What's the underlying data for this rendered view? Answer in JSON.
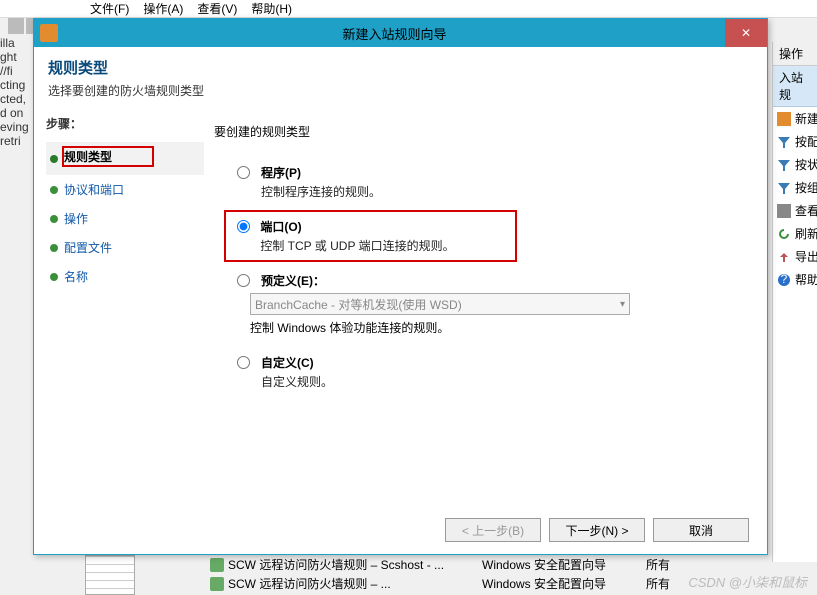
{
  "menubar": {
    "file": "文件(F)",
    "action": "操作(A)",
    "view": "查看(V)",
    "help": "帮助(H)"
  },
  "bg_text_lines": [
    "illa",
    "ght",
    "//fi",
    "cting",
    "cted,",
    "d on",
    "eving",
    "retri"
  ],
  "side": {
    "header": "操作",
    "group": "入站规",
    "items": [
      {
        "icon": "firewall-icon",
        "label": "新建"
      },
      {
        "icon": "filter-icon",
        "label": "按配"
      },
      {
        "icon": "filter-icon",
        "label": "按状"
      },
      {
        "icon": "filter-icon",
        "label": "按组"
      },
      {
        "icon": "view-icon",
        "label": "查看"
      },
      {
        "icon": "refresh-icon",
        "label": "刷新"
      },
      {
        "icon": "export-icon",
        "label": "导出"
      },
      {
        "icon": "help-icon",
        "label": "帮助"
      }
    ]
  },
  "status": {
    "row1": {
      "name": "SCW 远程访问防火墙规则 – Scshost - ...",
      "group": "Windows 安全配置向导",
      "extra": "所有"
    },
    "row2": {
      "name": "SCW 远程访问防火墙规则 – ...",
      "group": "Windows 安全配置向导",
      "extra": "所有"
    }
  },
  "watermark": "CSDN @小柒和鼠标",
  "wizard": {
    "title": "新建入站规则向导",
    "header": {
      "title": "规则类型",
      "subtitle": "选择要创建的防火墙规则类型"
    },
    "steps_label": "步骤：",
    "steps": [
      {
        "label": "规则类型",
        "current": true
      },
      {
        "label": "协议和端口"
      },
      {
        "label": "操作"
      },
      {
        "label": "配置文件"
      },
      {
        "label": "名称"
      }
    ],
    "prompt": "要创建的规则类型",
    "options": {
      "program": {
        "label": "程序(P)",
        "desc": "控制程序连接的规则。"
      },
      "port": {
        "label": "端口(O)",
        "desc": "控制 TCP 或 UDP 端口连接的规则。"
      },
      "predefined": {
        "label": "预定义(E)：",
        "desc": "控制 Windows 体验功能连接的规则。",
        "select_value": "BranchCache - 对等机发现(使用 WSD)"
      },
      "custom": {
        "label": "自定义(C)",
        "desc": "自定义规则。"
      }
    },
    "selected": "port",
    "buttons": {
      "back": "< 上一步(B)",
      "next": "下一步(N) >",
      "cancel": "取消"
    }
  }
}
